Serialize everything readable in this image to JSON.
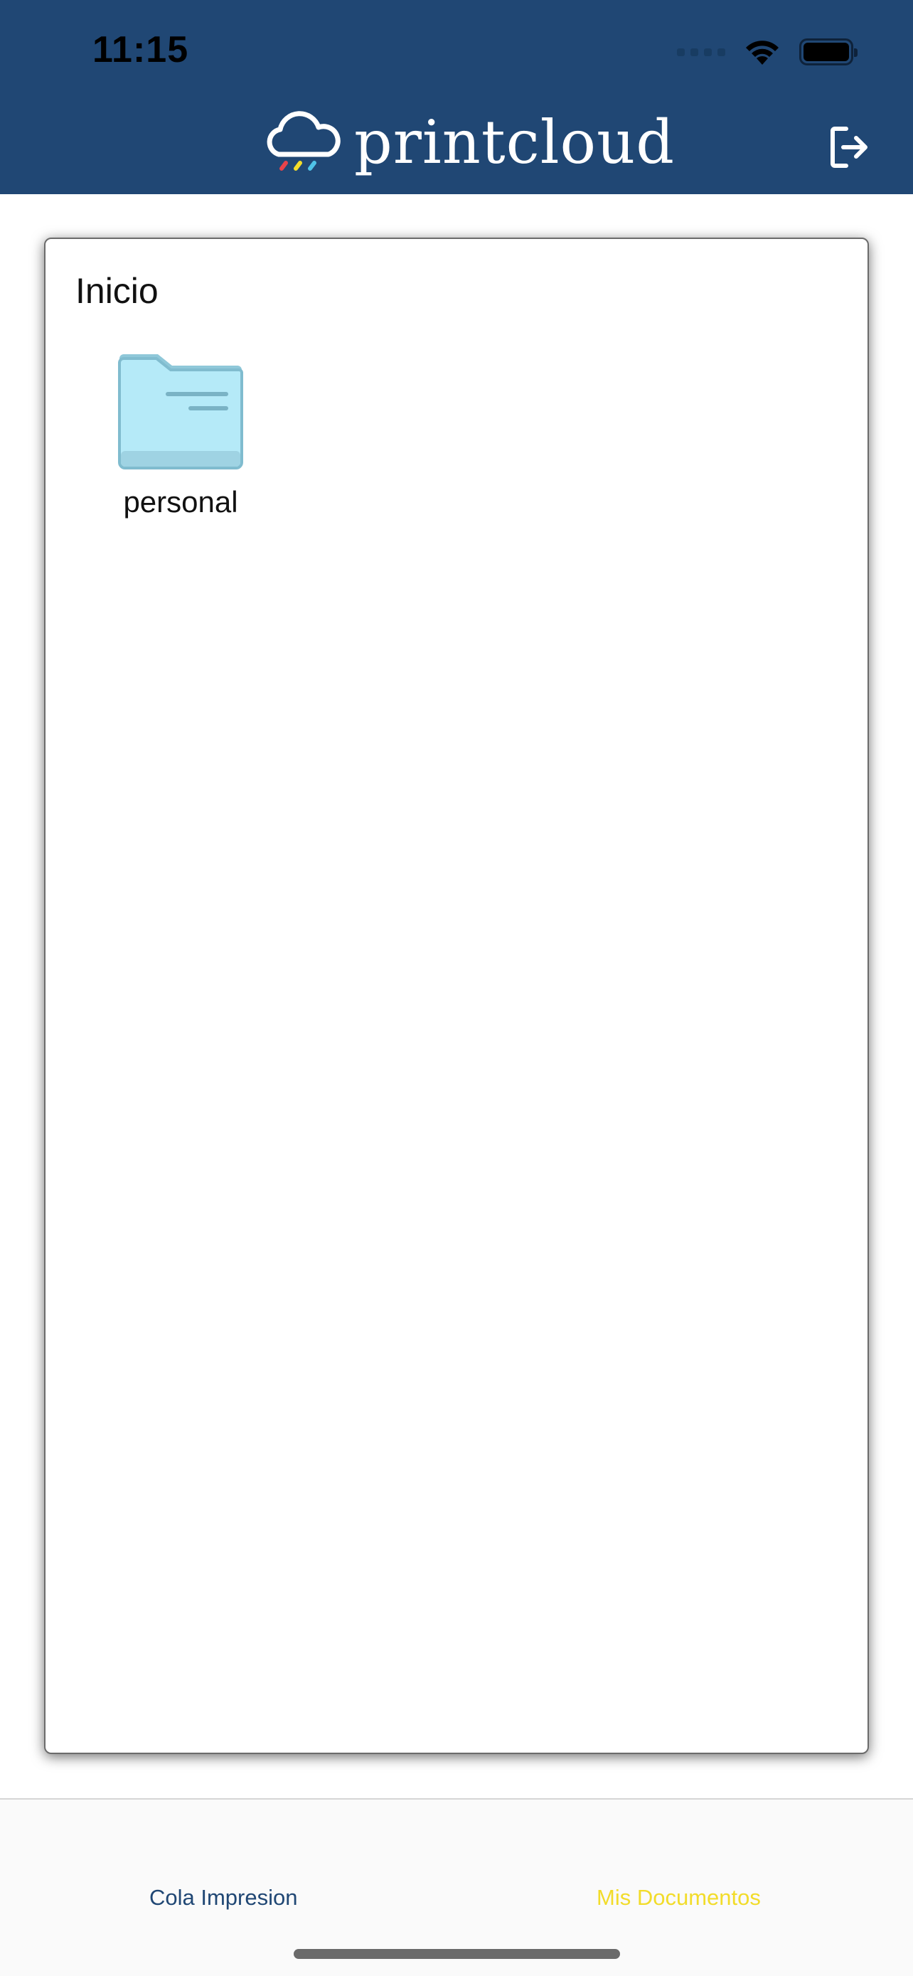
{
  "status_bar": {
    "time": "11:15",
    "icons": [
      "cellular-signal-icon",
      "wifi-icon",
      "battery-icon"
    ]
  },
  "header": {
    "logo_text": "printcloud",
    "logo_icon": "cloud-icon",
    "logout_icon": "logout-icon",
    "background_color": "#204774"
  },
  "browser": {
    "breadcrumb": "Inicio",
    "items": [
      {
        "type": "folder",
        "icon": "folder-icon",
        "label": "personal"
      }
    ]
  },
  "tabbar": {
    "tabs": [
      {
        "label": "Cola Impresion",
        "active": false,
        "color": "#204774"
      },
      {
        "label": "Mis Documentos",
        "active": true,
        "color": "#f2dc2a"
      }
    ]
  }
}
